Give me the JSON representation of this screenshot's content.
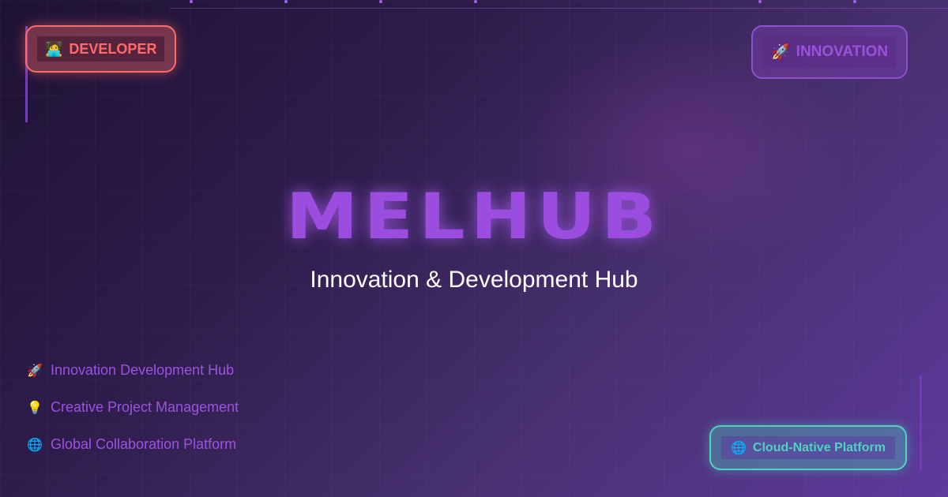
{
  "colors": {
    "accent": "#9b4ddf",
    "developer": "#ff6b6b",
    "cloud": "#4ed3c0"
  },
  "badges": {
    "developer": {
      "icon": "🧑‍💻",
      "icon_name": "technologist-icon",
      "label": "DEVELOPER"
    },
    "innovation": {
      "icon": "🚀",
      "icon_name": "rocket-icon",
      "label": "INNOVATION"
    },
    "cloud": {
      "icon": "🌐",
      "icon_name": "globe-icon",
      "label": "Cloud-Native Platform"
    }
  },
  "hero": {
    "title": "MELHUB",
    "subtitle": "Innovation & Development Hub"
  },
  "features": [
    {
      "icon": "🚀",
      "icon_name": "rocket-icon",
      "label": "Innovation Development Hub"
    },
    {
      "icon": "💡",
      "icon_name": "lightbulb-icon",
      "label": "Creative Project Management"
    },
    {
      "icon": "🌐",
      "icon_name": "globe-icon",
      "label": "Global Collaboration Platform"
    }
  ]
}
